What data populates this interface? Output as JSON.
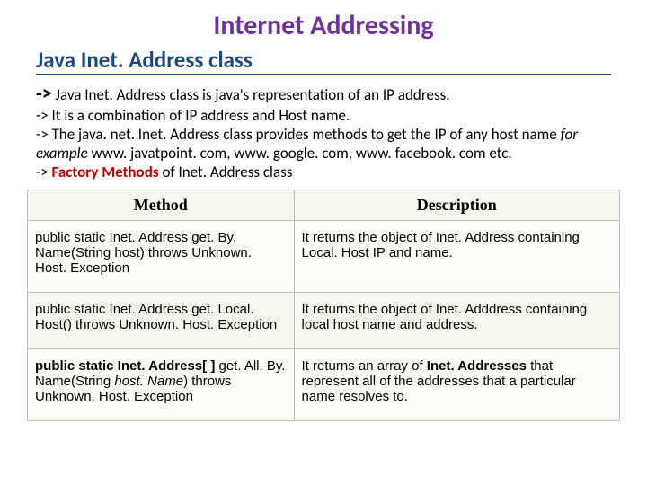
{
  "title": "Internet Addressing",
  "subtitle": "Java Inet. Address class",
  "arrow_lg": "->",
  "line1_tail": " Java Inet. Address class is java's representation of  an IP address.",
  "line2": "-> It is a combination of IP address and Host name.",
  "line3a": "-> The java. net. Inet. Address class provides methods to get the IP of any host name ",
  "line3_italic": "for example",
  "line3b": "  www. javatpoint. com, www. google. com, www. facebook. com etc.",
  "line4_arrow": "-> ",
  "line4_fm": "Factory Methods",
  "line4_tail": " of Inet. Address class",
  "table": {
    "headers": {
      "method": "Method",
      "description": "Description"
    },
    "rows": [
      {
        "method_html": "public static Inet. Address get. By. Name(String host) throws Unknown. Host. Exception",
        "desc_html": "It returns the object of Inet. Address containing Local. Host IP and name."
      },
      {
        "method_html": "public static Inet. Address get. Local. Host() throws Unknown. Host. Exception",
        "desc_html": "It returns the object of Inet. Adddress containing local host name and address."
      },
      {
        "method_bold_a": "public static Inet. Address[ ] ",
        "method_plain_a": "get. All. By. Name(String ",
        "method_italic": "host. Name",
        "method_plain_b": ") throws Unknown. Host. Exception",
        "desc_pre": "It returns an array of ",
        "desc_bold": "Inet. Addresses ",
        "desc_post": "that represent all of the addresses that a particular name resolves to."
      }
    ]
  }
}
